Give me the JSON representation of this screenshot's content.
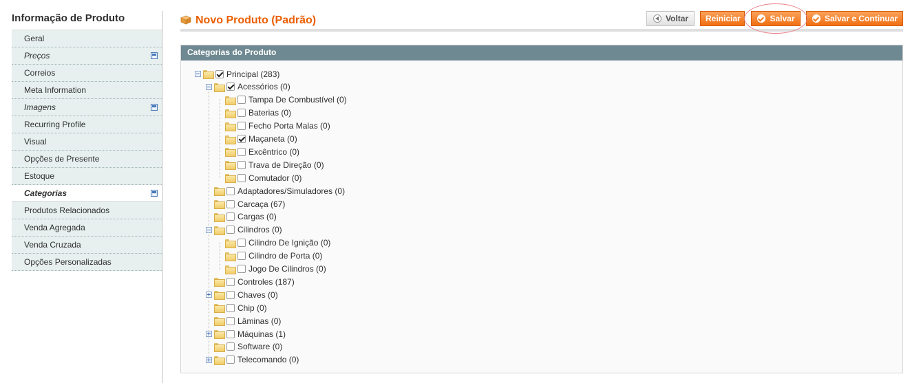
{
  "sidebar": {
    "title": "Informação de Produto",
    "tabs": [
      {
        "label": "Geral",
        "italic": false,
        "changed": false,
        "active": false
      },
      {
        "label": "Preços",
        "italic": true,
        "changed": true,
        "active": false
      },
      {
        "label": "Correios",
        "italic": false,
        "changed": false,
        "active": false
      },
      {
        "label": "Meta Information",
        "italic": false,
        "changed": false,
        "active": false
      },
      {
        "label": "Imagens",
        "italic": true,
        "changed": true,
        "active": false
      },
      {
        "label": "Recurring Profile",
        "italic": false,
        "changed": false,
        "active": false
      },
      {
        "label": "Visual",
        "italic": false,
        "changed": false,
        "active": false
      },
      {
        "label": "Opções de Presente",
        "italic": false,
        "changed": false,
        "active": false
      },
      {
        "label": "Estoque",
        "italic": false,
        "changed": false,
        "active": false
      },
      {
        "label": "Categorias",
        "italic": true,
        "changed": true,
        "active": true
      },
      {
        "label": "Produtos Relacionados",
        "italic": false,
        "changed": false,
        "active": false
      },
      {
        "label": "Venda Agregada",
        "italic": false,
        "changed": false,
        "active": false
      },
      {
        "label": "Venda Cruzada",
        "italic": false,
        "changed": false,
        "active": false
      },
      {
        "label": "Opções Personalizadas",
        "italic": false,
        "changed": false,
        "active": false
      }
    ]
  },
  "header": {
    "title": "Novo Produto (Padrão)",
    "back_label": "Voltar",
    "reset_label": "Reiniciar",
    "save_label": "Salvar",
    "save_continue_label": "Salvar e Continuar"
  },
  "panel": {
    "title": "Categorias do Produto"
  },
  "colors": {
    "accent_orange": "#eb5e00",
    "panel_header": "#6f8992",
    "highlight": "#e9808a"
  },
  "tree": [
    {
      "label": "Principal (283)",
      "level": 0,
      "expander": "minus",
      "checked": true
    },
    {
      "label": "Acessórios (0)",
      "level": 1,
      "expander": "minus",
      "checked": true
    },
    {
      "label": "Tampa De Combustível (0)",
      "level": 2,
      "expander": "none",
      "checked": false
    },
    {
      "label": "Baterias (0)",
      "level": 2,
      "expander": "none",
      "checked": false
    },
    {
      "label": "Fecho Porta Malas (0)",
      "level": 2,
      "expander": "none",
      "checked": false
    },
    {
      "label": "Maçaneta (0)",
      "level": 2,
      "expander": "none",
      "checked": true
    },
    {
      "label": "Excêntrico (0)",
      "level": 2,
      "expander": "none",
      "checked": false
    },
    {
      "label": "Trava de Direção (0)",
      "level": 2,
      "expander": "none",
      "checked": false
    },
    {
      "label": "Comutador (0)",
      "level": 2,
      "expander": "none",
      "checked": false
    },
    {
      "label": "Adaptadores/Simuladores (0)",
      "level": 1,
      "expander": "none",
      "checked": false
    },
    {
      "label": "Carcaça (67)",
      "level": 1,
      "expander": "none",
      "checked": false
    },
    {
      "label": "Cargas (0)",
      "level": 1,
      "expander": "none",
      "checked": false
    },
    {
      "label": "Cilindros (0)",
      "level": 1,
      "expander": "minus",
      "checked": false
    },
    {
      "label": "Cilindro De Ignição (0)",
      "level": 2,
      "expander": "none",
      "checked": false
    },
    {
      "label": "Cilindro de Porta (0)",
      "level": 2,
      "expander": "none",
      "checked": false
    },
    {
      "label": "Jogo De Cilindros (0)",
      "level": 2,
      "expander": "none",
      "checked": false
    },
    {
      "label": "Controles (187)",
      "level": 1,
      "expander": "none",
      "checked": false
    },
    {
      "label": "Chaves (0)",
      "level": 1,
      "expander": "plus",
      "checked": false
    },
    {
      "label": "Chip (0)",
      "level": 1,
      "expander": "none",
      "checked": false
    },
    {
      "label": "Lâminas (0)",
      "level": 1,
      "expander": "none",
      "checked": false
    },
    {
      "label": "Máquinas (1)",
      "level": 1,
      "expander": "plus",
      "checked": false
    },
    {
      "label": "Software (0)",
      "level": 1,
      "expander": "none",
      "checked": false
    },
    {
      "label": "Telecomando (0)",
      "level": 1,
      "expander": "plus",
      "checked": false
    }
  ]
}
